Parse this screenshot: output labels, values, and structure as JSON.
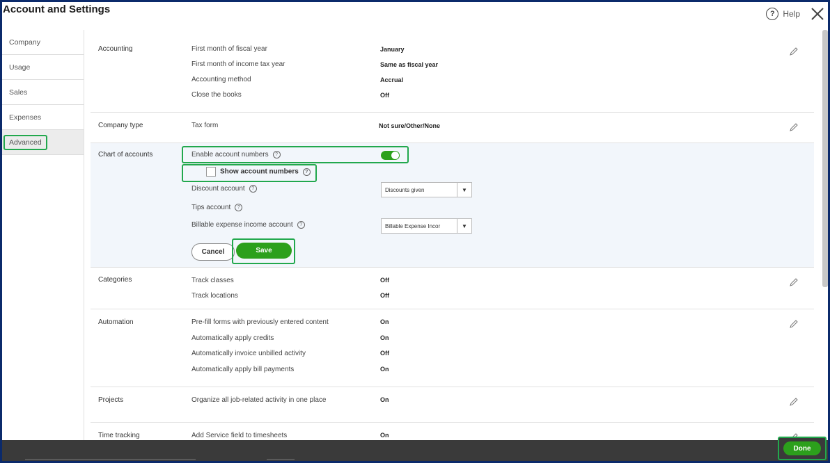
{
  "header": {
    "title": "Account and Settings",
    "help_label": "Help",
    "help_icon": "?"
  },
  "sidebar": {
    "items": [
      {
        "label": "Company"
      },
      {
        "label": "Usage"
      },
      {
        "label": "Sales"
      },
      {
        "label": "Expenses"
      },
      {
        "label": "Advanced",
        "active": true
      }
    ]
  },
  "sections": {
    "accounting": {
      "title": "Accounting",
      "rows": [
        {
          "label": "First month of fiscal year",
          "value": "January"
        },
        {
          "label": "First month of income tax year",
          "value": "Same as fiscal year"
        },
        {
          "label": "Accounting method",
          "value": "Accrual"
        },
        {
          "label": "Close the books",
          "value": "Off"
        }
      ]
    },
    "company_type": {
      "title": "Company type",
      "rows": [
        {
          "label": "Tax form",
          "value": "Not sure/Other/None"
        }
      ]
    },
    "chart_of_accounts": {
      "title": "Chart of accounts",
      "enable_label": "Enable account numbers",
      "enable_on": true,
      "show_label": "Show account numbers",
      "discount_label": "Discount account",
      "discount_value": "Discounts given",
      "tips_label": "Tips account",
      "billable_label": "Billable expense income account",
      "billable_value": "Billable Expense Incor",
      "cancel_label": "Cancel",
      "save_label": "Save",
      "help_mark": "?",
      "dropdown_arrow": "▼"
    },
    "categories": {
      "title": "Categories",
      "rows": [
        {
          "label": "Track classes",
          "value": "Off"
        },
        {
          "label": "Track locations",
          "value": "Off"
        }
      ]
    },
    "automation": {
      "title": "Automation",
      "rows": [
        {
          "label": "Pre-fill forms with previously entered content",
          "value": "On"
        },
        {
          "label": "Automatically apply credits",
          "value": "On"
        },
        {
          "label": "Automatically invoice unbilled activity",
          "value": "Off"
        },
        {
          "label": "Automatically apply bill payments",
          "value": "On"
        }
      ]
    },
    "projects": {
      "title": "Projects",
      "rows": [
        {
          "label": "Organize all job-related activity in one place",
          "value": "On"
        }
      ]
    },
    "time_tracking": {
      "title": "Time tracking",
      "rows": [
        {
          "label": "Add Service field to timesheets",
          "value": "On"
        }
      ]
    }
  },
  "footer": {
    "done_label": "Done"
  },
  "colors": {
    "accent_green": "#2ca01c",
    "highlight_outline": "#22a84d",
    "frame_blue": "#0b2a6b"
  }
}
